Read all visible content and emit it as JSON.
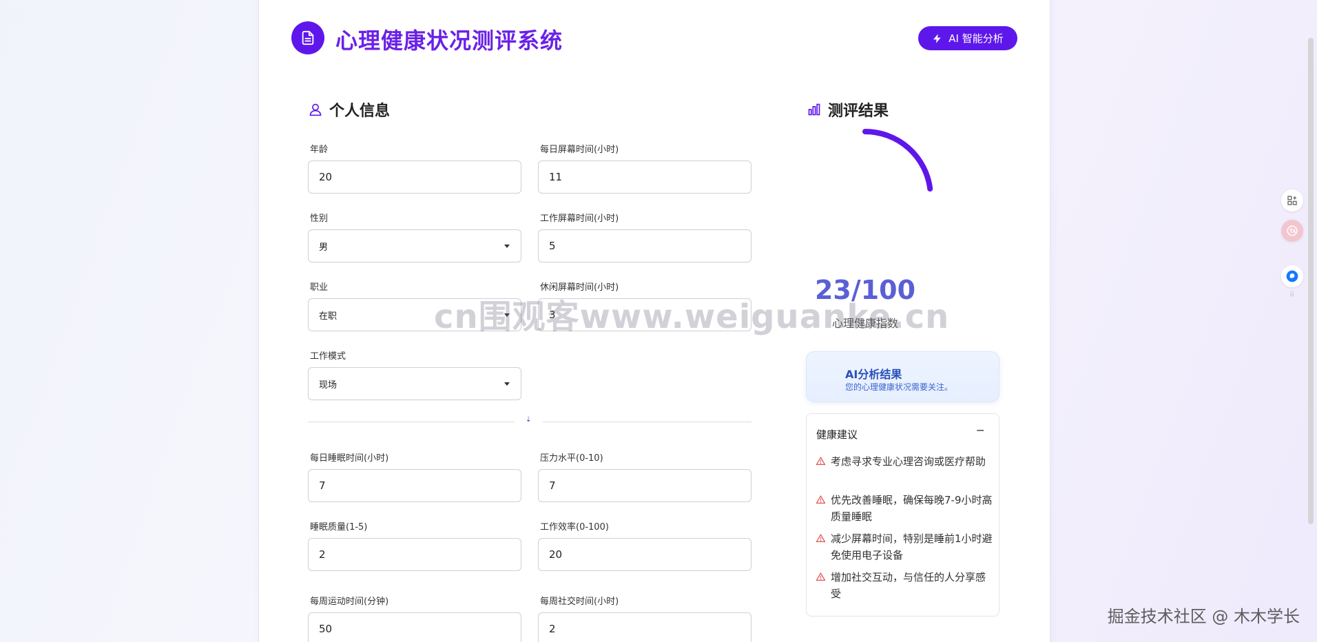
{
  "header": {
    "title": "心理健康状况测评系统",
    "ai_button_label": "AI 智能分析"
  },
  "personal_info": {
    "section_title": "个人信息",
    "fields": [
      {
        "label": "年龄",
        "value": "20"
      },
      {
        "label": "每日屏幕时间(小时)",
        "value": "11"
      },
      {
        "label": "性别",
        "value": "男"
      },
      {
        "label": "工作屏幕时间(小时)",
        "value": "5"
      },
      {
        "label": "职业",
        "value": "在职"
      },
      {
        "label": "休闲屏幕时间(小时)",
        "value": "3"
      },
      {
        "label": "工作模式",
        "value": "现场"
      }
    ],
    "lifestyle_fields": [
      {
        "label": "每日睡眠时间(小时)",
        "value": "7"
      },
      {
        "label": "压力水平(0-10)",
        "value": "7"
      },
      {
        "label": "睡眠质量(1-5)",
        "value": "2"
      },
      {
        "label": "工作效率(0-100)",
        "value": "20"
      },
      {
        "label": "每周运动时间(分钟)",
        "value": "50"
      },
      {
        "label": "每周社交时间(小时)",
        "value": "2"
      }
    ]
  },
  "results": {
    "section_title": "测评结果",
    "score_text": "23/100",
    "score_value": 23,
    "score_max": 100,
    "score_label": "心理健康指数",
    "ai_result_title": "AI分析结果",
    "ai_result_subtitle": "您的心理健康状况需要关注。",
    "advice_title": "健康建议",
    "advice_collapse": "−",
    "advice_items": [
      "考虑寻求专业心理咨询或医疗帮助",
      "优先改善睡眠，确保每晚7-9小时高质量睡眠",
      "减少屏幕时间，特别是睡前1小时避免使用电子设备",
      "增加社交互动，与信任的人分享感受"
    ]
  },
  "watermark": "cn围观客www.weiguanke.cn",
  "corner_credit": "掘金技术社区 @ 木木学长",
  "colors": {
    "accent": "#5e17eb",
    "title": "#6a21e8",
    "score": "#5b5fd6",
    "warning": "#e04848"
  },
  "icons": [
    "document-icon",
    "lightning-icon",
    "user-icon",
    "bar-chart-icon",
    "warning-icon",
    "grid-add-icon",
    "translate-icon",
    "chat-icon"
  ]
}
